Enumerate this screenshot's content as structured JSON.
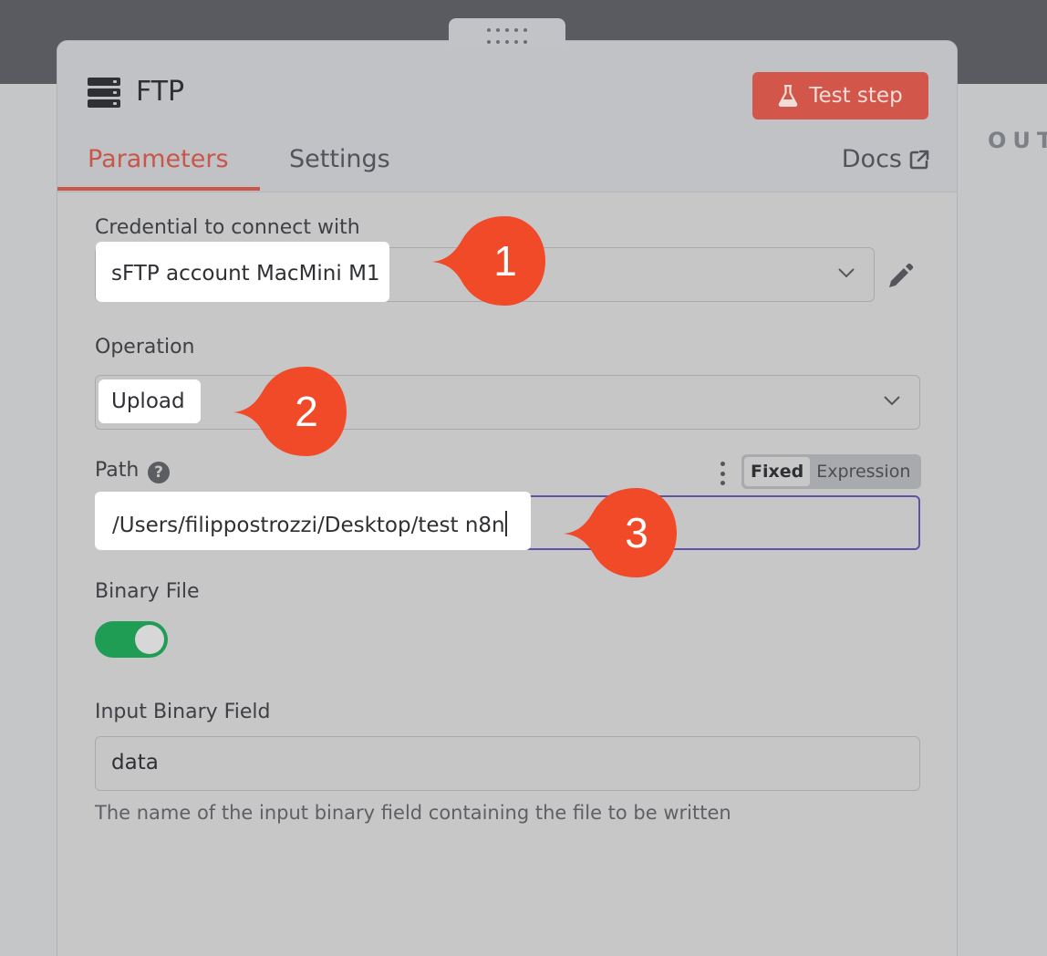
{
  "background": {
    "output_label": "OUT"
  },
  "node": {
    "title": "FTP",
    "test_button": "Test step"
  },
  "tabs": [
    {
      "label": "Parameters",
      "active": true
    },
    {
      "label": "Settings",
      "active": false
    }
  ],
  "docs_label": "Docs",
  "credential": {
    "label": "Credential to connect with",
    "value": "sFTP account MacMini M1"
  },
  "operation": {
    "label": "Operation",
    "value": "Upload"
  },
  "path": {
    "label": "Path",
    "value": "/Users/filippostrozzi/Desktop/test n8n",
    "mode_fixed": "Fixed",
    "mode_expression": "Expression"
  },
  "binary_file": {
    "label": "Binary File",
    "enabled": true
  },
  "input_binary_field": {
    "label": "Input Binary Field",
    "value": "data",
    "hint": "The name of the input binary field containing the file to be written"
  },
  "annotations": [
    "1",
    "2",
    "3"
  ],
  "colors": {
    "accent": "#c85649",
    "annotation": "#f04a28",
    "toggle_on": "#1f9d55",
    "focus": "#6152a5"
  }
}
